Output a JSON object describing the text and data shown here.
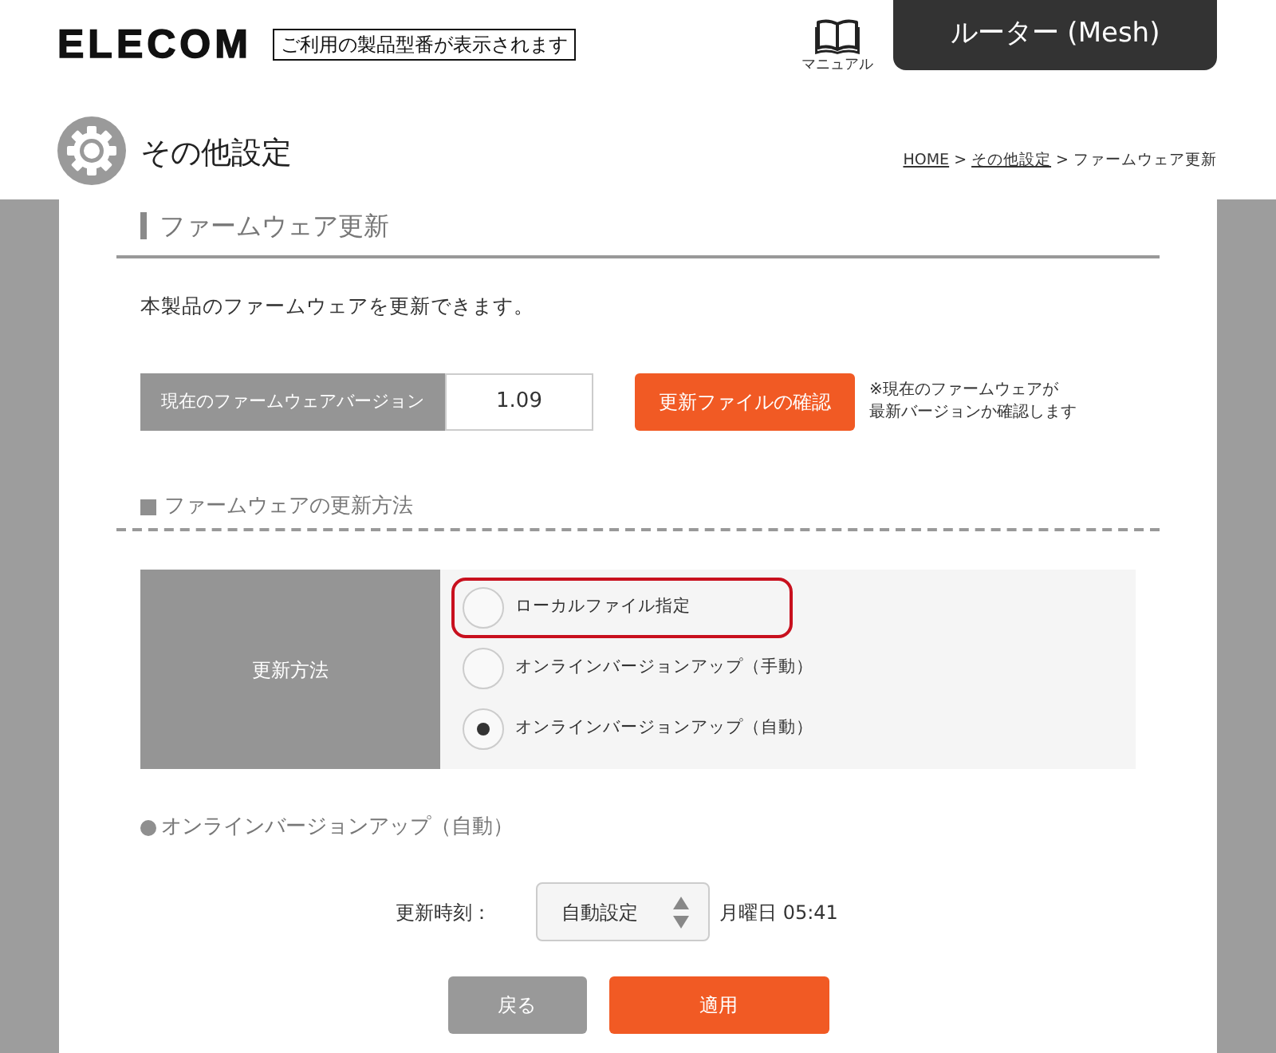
{
  "header": {
    "logo": "ELECOM",
    "model_label": "ご利用の製品型番が表示されます",
    "manual_label": "マニュアル",
    "device_tab": "ルーター (Mesh)"
  },
  "page_header": {
    "title": "その他設定",
    "breadcrumb": [
      {
        "label": "HOME",
        "kind": "link"
      },
      {
        "label": ">",
        "kind": "separator"
      },
      {
        "label": "その他設定",
        "kind": "link"
      },
      {
        "label": ">",
        "kind": "separator"
      },
      {
        "label": "ファームウェア更新",
        "kind": "current"
      }
    ]
  },
  "section": {
    "title": "ファームウェア更新",
    "description": "本製品のファームウェアを更新できます。"
  },
  "firmware_version": {
    "label": "現在のファームウェアバージョン",
    "value": "1.09",
    "check_button": "更新ファイルの確認",
    "note_lines": [
      "※現在のファームウェアが",
      "最新バージョンか確認します"
    ]
  },
  "update_method": {
    "heading": "ファームウェアの更新方法",
    "label": "更新方法",
    "options": [
      {
        "label": "ローカルファイル指定",
        "selected": false,
        "highlighted": true
      },
      {
        "label": "オンラインバージョンアップ（手動）",
        "selected": false,
        "highlighted": false
      },
      {
        "label": "オンラインバージョンアップ（自動）",
        "selected": true,
        "highlighted": false
      }
    ]
  },
  "auto_update": {
    "heading": "オンラインバージョンアップ（自動）",
    "time_label": "更新時刻：",
    "time_select": "自動設定",
    "schedule": "月曜日 05:41"
  },
  "buttons": [
    {
      "label": "戻る",
      "kind": "secondary"
    },
    {
      "label": "適用",
      "kind": "primary"
    }
  ]
}
